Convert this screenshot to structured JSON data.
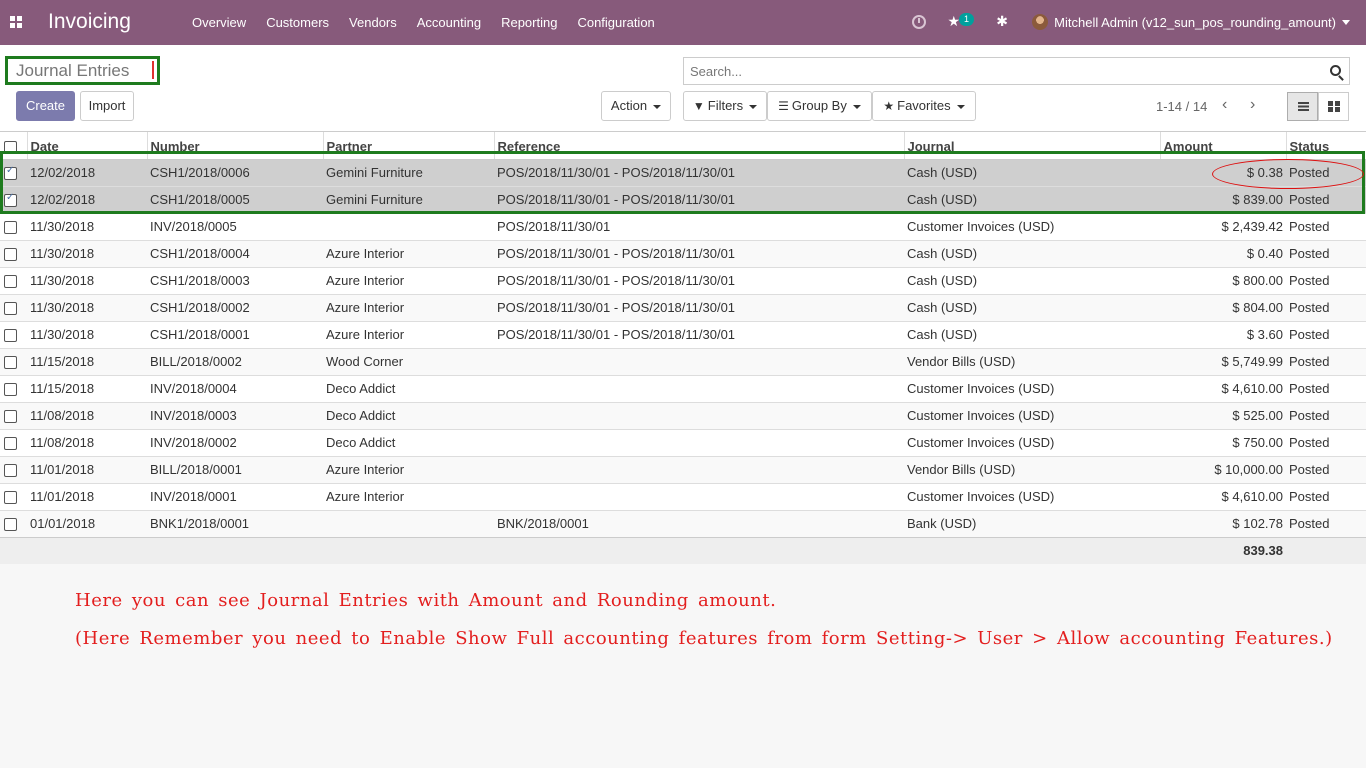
{
  "app": {
    "title": "Invoicing"
  },
  "nav": {
    "menu": [
      "Overview",
      "Customers",
      "Vendors",
      "Accounting",
      "Reporting",
      "Configuration"
    ],
    "messages_count": "1",
    "user": "Mitchell Admin (v12_sun_pos_rounding_amount)"
  },
  "control_panel": {
    "breadcrumb": "Journal Entries",
    "create_label": "Create",
    "import_label": "Import",
    "action_label": "Action",
    "search_placeholder": "Search...",
    "filters_label": "Filters",
    "groupby_label": "Group By",
    "favorites_label": "Favorites",
    "pager": "1-14 / 14"
  },
  "table": {
    "columns": [
      "Date",
      "Number",
      "Partner",
      "Reference",
      "Journal",
      "Amount",
      "Status"
    ],
    "rows": [
      {
        "selected": true,
        "date": "12/02/2018",
        "number": "CSH1/2018/0006",
        "partner": "Gemini Furniture",
        "reference": "POS/2018/11/30/01 - POS/2018/11/30/01",
        "journal": "Cash (USD)",
        "amount": "$ 0.38",
        "status": "Posted"
      },
      {
        "selected": true,
        "date": "12/02/2018",
        "number": "CSH1/2018/0005",
        "partner": "Gemini Furniture",
        "reference": "POS/2018/11/30/01 - POS/2018/11/30/01",
        "journal": "Cash (USD)",
        "amount": "$ 839.00",
        "status": "Posted"
      },
      {
        "selected": false,
        "date": "11/30/2018",
        "number": "INV/2018/0005",
        "partner": "",
        "reference": "POS/2018/11/30/01",
        "journal": "Customer Invoices (USD)",
        "amount": "$ 2,439.42",
        "status": "Posted"
      },
      {
        "selected": false,
        "date": "11/30/2018",
        "number": "CSH1/2018/0004",
        "partner": "Azure Interior",
        "reference": "POS/2018/11/30/01 - POS/2018/11/30/01",
        "journal": "Cash (USD)",
        "amount": "$ 0.40",
        "status": "Posted"
      },
      {
        "selected": false,
        "date": "11/30/2018",
        "number": "CSH1/2018/0003",
        "partner": "Azure Interior",
        "reference": "POS/2018/11/30/01 - POS/2018/11/30/01",
        "journal": "Cash (USD)",
        "amount": "$ 800.00",
        "status": "Posted"
      },
      {
        "selected": false,
        "date": "11/30/2018",
        "number": "CSH1/2018/0002",
        "partner": "Azure Interior",
        "reference": "POS/2018/11/30/01 - POS/2018/11/30/01",
        "journal": "Cash (USD)",
        "amount": "$ 804.00",
        "status": "Posted"
      },
      {
        "selected": false,
        "date": "11/30/2018",
        "number": "CSH1/2018/0001",
        "partner": "Azure Interior",
        "reference": "POS/2018/11/30/01 - POS/2018/11/30/01",
        "journal": "Cash (USD)",
        "amount": "$ 3.60",
        "status": "Posted"
      },
      {
        "selected": false,
        "date": "11/15/2018",
        "number": "BILL/2018/0002",
        "partner": "Wood Corner",
        "reference": "",
        "journal": "Vendor Bills (USD)",
        "amount": "$ 5,749.99",
        "status": "Posted"
      },
      {
        "selected": false,
        "date": "11/15/2018",
        "number": "INV/2018/0004",
        "partner": "Deco Addict",
        "reference": "",
        "journal": "Customer Invoices (USD)",
        "amount": "$ 4,610.00",
        "status": "Posted"
      },
      {
        "selected": false,
        "date": "11/08/2018",
        "number": "INV/2018/0003",
        "partner": "Deco Addict",
        "reference": "",
        "journal": "Customer Invoices (USD)",
        "amount": "$ 525.00",
        "status": "Posted"
      },
      {
        "selected": false,
        "date": "11/08/2018",
        "number": "INV/2018/0002",
        "partner": "Deco Addict",
        "reference": "",
        "journal": "Customer Invoices (USD)",
        "amount": "$ 750.00",
        "status": "Posted"
      },
      {
        "selected": false,
        "date": "11/01/2018",
        "number": "BILL/2018/0001",
        "partner": "Azure Interior",
        "reference": "",
        "journal": "Vendor Bills (USD)",
        "amount": "$ 10,000.00",
        "status": "Posted"
      },
      {
        "selected": false,
        "date": "11/01/2018",
        "number": "INV/2018/0001",
        "partner": "Azure Interior",
        "reference": "",
        "journal": "Customer Invoices (USD)",
        "amount": "$ 4,610.00",
        "status": "Posted"
      },
      {
        "selected": false,
        "date": "01/01/2018",
        "number": "BNK1/2018/0001",
        "partner": "",
        "reference": "BNK/2018/0001",
        "journal": "Bank (USD)",
        "amount": "$ 102.78",
        "status": "Posted"
      }
    ],
    "total_amount": "839.38"
  },
  "annotations": {
    "line1": "Here you can see Journal Entries with Amount and Rounding amount.",
    "line2": "(Here Remember you need to Enable Show Full accounting features from form Setting-> User > Allow accounting Features.)"
  },
  "colors": {
    "navbar": "#875a7b",
    "primary": "#7c7bad",
    "highlight_box": "#1e7b1e",
    "annotation_text": "#e31e1e"
  }
}
